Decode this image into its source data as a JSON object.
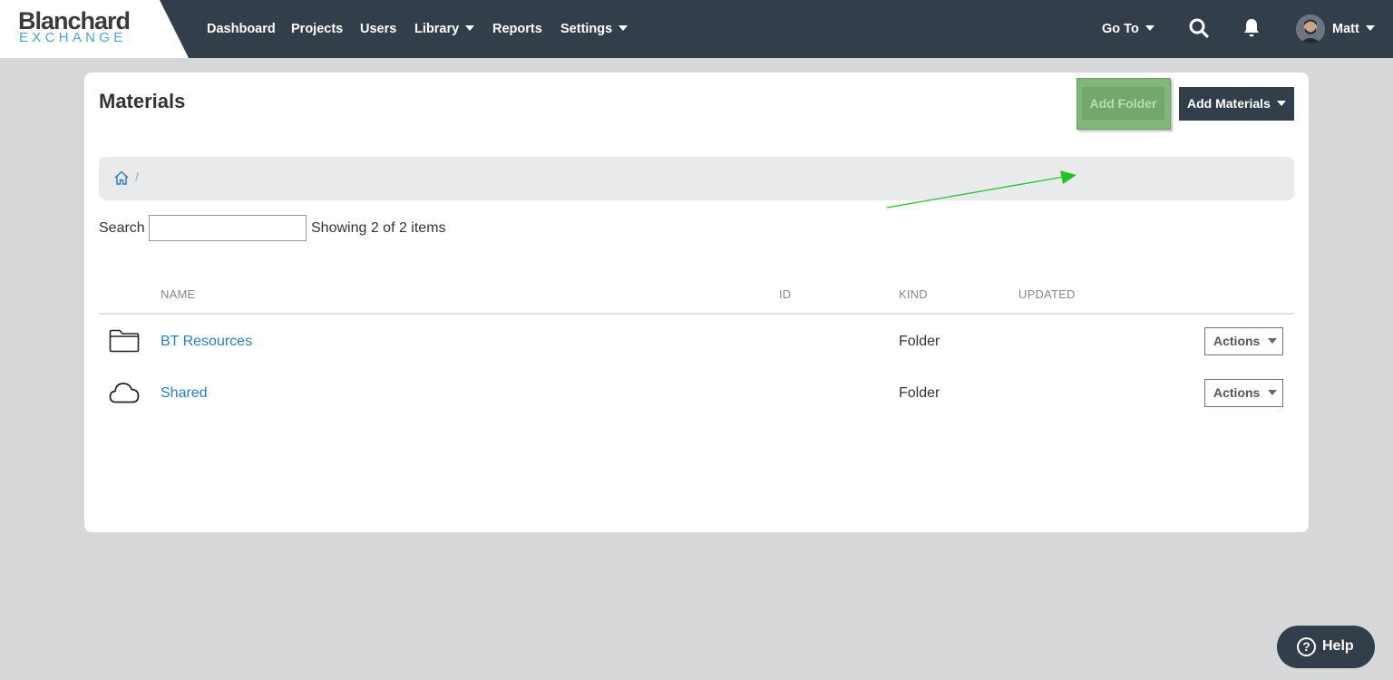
{
  "brand": {
    "name_top": "Blanchard",
    "name_bottom": "EXCHANGE"
  },
  "nav": {
    "items": [
      {
        "label": "Dashboard"
      },
      {
        "label": "Projects"
      },
      {
        "label": "Users"
      },
      {
        "label": "Library"
      },
      {
        "label": "Reports"
      },
      {
        "label": "Settings"
      }
    ],
    "goto_label": "Go To",
    "user_name": "Matt"
  },
  "page": {
    "title": "Materials",
    "add_folder_label": "Add Folder",
    "add_materials_label": "Add Materials",
    "breadcrumb_separator": "/"
  },
  "search": {
    "label": "Search",
    "value": "",
    "placeholder": "",
    "status": "Showing 2 of 2 items"
  },
  "table": {
    "columns": [
      "NAME",
      "ID",
      "KIND",
      "UPDATED"
    ],
    "rows": [
      {
        "icon": "folder-icon",
        "name": "BT Resources",
        "id": "",
        "kind": "Folder",
        "updated": "",
        "action_label": "Actions"
      },
      {
        "icon": "cloud-icon",
        "name": "Shared",
        "id": "",
        "kind": "Folder",
        "updated": "",
        "action_label": "Actions"
      }
    ]
  },
  "help": {
    "label": "Help"
  },
  "colors": {
    "navbar": "#323f4b",
    "link": "#2a7fbf",
    "highlight": "#7fb978",
    "annotation_arrow": "#22c422"
  }
}
